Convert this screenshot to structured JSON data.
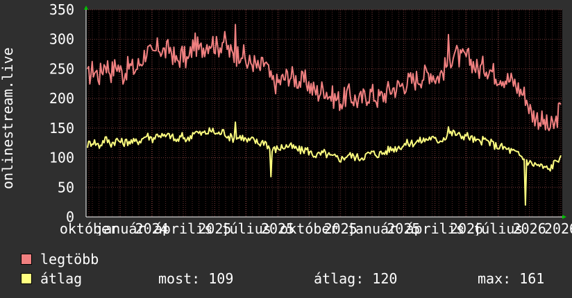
{
  "chart_data": {
    "type": "line",
    "ylabel": "onlinestream.live",
    "ylim": [
      0,
      350
    ],
    "yticks": [
      "0",
      "50",
      "100",
      "150",
      "200",
      "250",
      "300",
      "350"
    ],
    "xticks": [
      "október",
      "január",
      "2024",
      "április",
      "2025",
      "július",
      "2025",
      "október",
      "2025",
      "január",
      "2025",
      "április",
      "2026",
      "július",
      "2026",
      "2026"
    ],
    "grid": true,
    "x_range": [
      "2023-10-01",
      "2026-10-01"
    ],
    "series": [
      {
        "name": "legtöbb",
        "color": "#f08080",
        "points": [
          [
            0,
            235
          ],
          [
            1,
            250
          ],
          [
            2,
            238
          ],
          [
            3,
            262
          ],
          [
            4,
            245
          ],
          [
            5,
            258
          ],
          [
            6,
            240
          ],
          [
            7,
            255
          ],
          [
            8,
            248
          ],
          [
            9,
            262
          ],
          [
            10,
            282
          ],
          [
            11,
            270
          ],
          [
            12,
            288
          ],
          [
            13,
            278
          ],
          [
            14,
            285
          ],
          [
            15,
            260
          ],
          [
            16,
            275
          ],
          [
            17,
            262
          ],
          [
            18,
            295
          ],
          [
            19,
            280
          ],
          [
            20,
            292
          ],
          [
            21,
            298
          ],
          [
            22,
            285
          ],
          [
            23,
            300
          ],
          [
            24,
            278
          ],
          [
            25,
            270
          ],
          [
            26,
            282
          ],
          [
            27,
            258
          ],
          [
            28,
            262
          ],
          [
            29,
            248
          ],
          [
            30,
            262
          ],
          [
            31,
            230
          ],
          [
            32,
            225
          ],
          [
            33,
            232
          ],
          [
            34,
            240
          ],
          [
            35,
            235
          ],
          [
            36,
            228
          ],
          [
            37,
            230
          ],
          [
            38,
            215
          ],
          [
            39,
            210
          ],
          [
            40,
            218
          ],
          [
            41,
            205
          ],
          [
            42,
            200
          ],
          [
            43,
            195
          ],
          [
            44,
            208
          ],
          [
            45,
            200
          ],
          [
            46,
            195
          ],
          [
            47,
            205
          ],
          [
            48,
            210
          ],
          [
            49,
            200
          ],
          [
            50,
            205
          ],
          [
            51,
            215
          ],
          [
            52,
            218
          ],
          [
            53,
            222
          ],
          [
            54,
            228
          ],
          [
            55,
            230
          ],
          [
            56,
            235
          ],
          [
            57,
            240
          ],
          [
            58,
            245
          ],
          [
            59,
            235
          ],
          [
            60,
            245
          ],
          [
            61,
            262
          ],
          [
            62,
            280
          ],
          [
            63,
            265
          ],
          [
            64,
            270
          ],
          [
            65,
            262
          ],
          [
            66,
            248
          ],
          [
            67,
            255
          ],
          [
            68,
            250
          ],
          [
            69,
            240
          ],
          [
            70,
            238
          ],
          [
            71,
            232
          ],
          [
            72,
            228
          ],
          [
            73,
            215
          ],
          [
            74,
            205
          ],
          [
            75,
            175
          ],
          [
            76,
            168
          ],
          [
            77,
            160
          ],
          [
            78,
            150
          ],
          [
            79,
            155
          ],
          [
            80,
            190
          ]
        ]
      },
      {
        "name": "átlag",
        "color": "#ffff80",
        "points": [
          [
            0,
            122
          ],
          [
            1,
            128
          ],
          [
            2,
            120
          ],
          [
            3,
            132
          ],
          [
            4,
            124
          ],
          [
            5,
            130
          ],
          [
            6,
            125
          ],
          [
            7,
            128
          ],
          [
            8,
            126
          ],
          [
            9,
            130
          ],
          [
            10,
            138
          ],
          [
            11,
            132
          ],
          [
            12,
            140
          ],
          [
            13,
            135
          ],
          [
            14,
            138
          ],
          [
            15,
            128
          ],
          [
            16,
            136
          ],
          [
            17,
            130
          ],
          [
            18,
            145
          ],
          [
            19,
            140
          ],
          [
            20,
            142
          ],
          [
            21,
            146
          ],
          [
            22,
            140
          ],
          [
            23,
            144
          ],
          [
            24,
            135
          ],
          [
            25,
            132
          ],
          [
            26,
            136
          ],
          [
            27,
            128
          ],
          [
            28,
            130
          ],
          [
            29,
            124
          ],
          [
            30,
            128
          ],
          [
            31,
            112
          ],
          [
            32,
            115
          ],
          [
            33,
            118
          ],
          [
            34,
            120
          ],
          [
            35,
            116
          ],
          [
            36,
            112
          ],
          [
            37,
            114
          ],
          [
            38,
            106
          ],
          [
            39,
            104
          ],
          [
            40,
            108
          ],
          [
            41,
            102
          ],
          [
            42,
            100
          ],
          [
            43,
            98
          ],
          [
            44,
            105
          ],
          [
            45,
            102
          ],
          [
            46,
            100
          ],
          [
            47,
            104
          ],
          [
            48,
            108
          ],
          [
            49,
            106
          ],
          [
            50,
            108
          ],
          [
            51,
            114
          ],
          [
            52,
            116
          ],
          [
            53,
            120
          ],
          [
            54,
            124
          ],
          [
            55,
            125
          ],
          [
            56,
            128
          ],
          [
            57,
            130
          ],
          [
            58,
            134
          ],
          [
            59,
            128
          ],
          [
            60,
            132
          ],
          [
            61,
            140
          ],
          [
            62,
            142
          ],
          [
            63,
            136
          ],
          [
            64,
            138
          ],
          [
            65,
            132
          ],
          [
            66,
            126
          ],
          [
            67,
            130
          ],
          [
            68,
            126
          ],
          [
            69,
            120
          ],
          [
            70,
            118
          ],
          [
            71,
            114
          ],
          [
            72,
            110
          ],
          [
            73,
            104
          ],
          [
            74,
            96
          ],
          [
            75,
            90
          ],
          [
            76,
            88
          ],
          [
            77,
            84
          ],
          [
            78,
            80
          ],
          [
            79,
            92
          ],
          [
            80,
            104
          ]
        ]
      }
    ],
    "spikes": [
      {
        "series": 0,
        "at": 25,
        "value": 325
      },
      {
        "series": 0,
        "at": 61,
        "value": 308
      },
      {
        "series": 1,
        "at": 31,
        "value": 68
      },
      {
        "series": 1,
        "at": 74,
        "value": 20
      },
      {
        "series": 1,
        "at": 25,
        "value": 160
      },
      {
        "series": 1,
        "at": 61,
        "value": 152
      }
    ]
  },
  "legend": [
    {
      "name": "legtöbb",
      "color": "#f08080"
    },
    {
      "name": "átlag",
      "color": "#ffff80"
    }
  ],
  "stats": {
    "most": "most: 109",
    "atlag": "átlag: 120",
    "max": "max: 161"
  }
}
